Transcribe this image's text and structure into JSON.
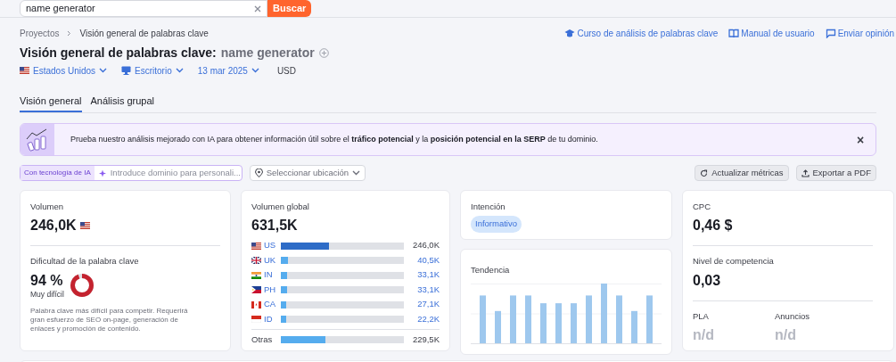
{
  "search": {
    "value": "name generator",
    "button": "Buscar"
  },
  "breadcrumb": [
    "Proyectos",
    "Visión general de palabras clave"
  ],
  "help_links": [
    {
      "kind": "course",
      "label": "Curso de análisis de palabras clave"
    },
    {
      "kind": "manual",
      "label": "Manual de usuario"
    },
    {
      "kind": "feedback",
      "label": "Enviar opinión"
    }
  ],
  "title": {
    "label": "Visión general de palabras clave:",
    "keyword": "name generator"
  },
  "filters": [
    {
      "kind": "country",
      "label": "Estados Unidos"
    },
    {
      "kind": "device",
      "label": "Escritorio"
    },
    {
      "kind": "date",
      "label": "13 mar 2025"
    },
    {
      "kind": "plain",
      "label": "USD"
    }
  ],
  "tabs": [
    {
      "label": "Visión general",
      "selected": true
    },
    {
      "label": "Análisis grupal",
      "selected": false
    }
  ],
  "banner": {
    "text": "Prueba nuestro análisis mejorado con IA para obtener información útil sobre el **tráfico potencial** y la **posición potencial en la SERP** de tu dominio.",
    "close": "×"
  },
  "toolbar": {
    "ai_badge": "Con tecnología de IA",
    "domain_placeholder": "Introduce dominio para personali...",
    "location": "Seleccionar ubicación",
    "buttons": [
      {
        "kind": "refresh",
        "label": "Actualizar métricas"
      },
      {
        "kind": "export",
        "label": "Exportar a PDF"
      }
    ]
  },
  "volume": {
    "label": "Volumen",
    "value": "246,0K"
  },
  "difficulty": {
    "label": "Dificultad de la palabra clave",
    "value": "94 %",
    "rating": "Muy difícil",
    "level": 0.94,
    "description": "Palabra clave más difícil para competir. Requerirá gran esfuerzo de SEO on-page, generación de enlaces y promoción de contenido."
  },
  "global_volume": {
    "label": "Volumen global",
    "value": "631,5K",
    "countries": [
      {
        "kind": "us",
        "code": "US",
        "value": "246,0K",
        "level": 0.39
      },
      {
        "kind": "uk",
        "code": "UK",
        "value": "40,5K",
        "level": 0.06
      },
      {
        "kind": "in",
        "code": "IN",
        "value": "33,1K",
        "level": 0.05
      },
      {
        "kind": "ph",
        "code": "PH",
        "value": "33,1K",
        "level": 0.05
      },
      {
        "kind": "ca",
        "code": "CA",
        "value": "27,1K",
        "level": 0.04
      },
      {
        "kind": "id",
        "code": "ID",
        "value": "22,2K",
        "level": 0.04
      }
    ],
    "other": {
      "label": "Otras",
      "value": "229,5K",
      "level": 0.36
    }
  },
  "intent": {
    "label": "Intención",
    "tag": "Informativo"
  },
  "trend": {
    "label": "Tendencia"
  },
  "cpc": {
    "label": "CPC",
    "value": "0,46 $"
  },
  "competition": {
    "label": "Nivel de competencia",
    "value": "0,03"
  },
  "pla": {
    "label": "PLA",
    "value": "n/d"
  },
  "ads": {
    "label": "Anuncios",
    "value": "n/d"
  }
}
